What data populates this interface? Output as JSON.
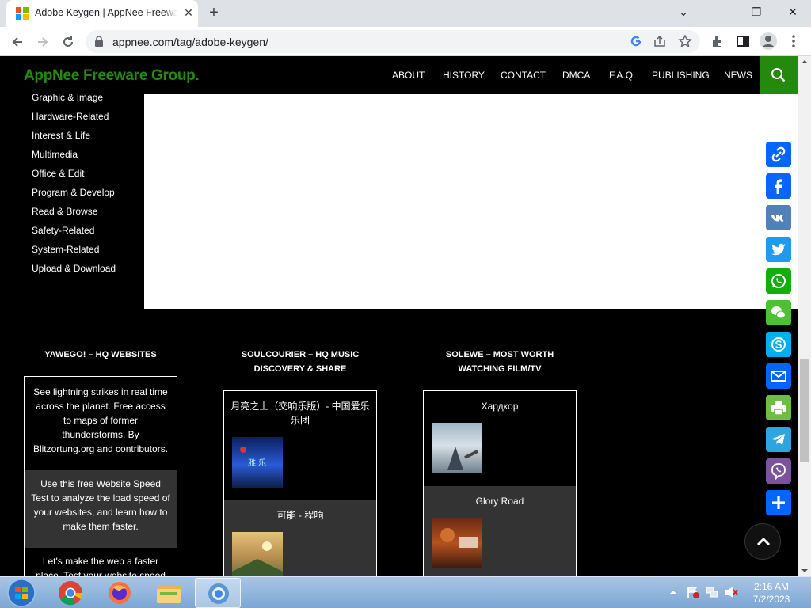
{
  "browser": {
    "tab_title": "Adobe Keygen | AppNee Freeware Group.",
    "tab_close": "✕",
    "new_tab": "+",
    "url": "appnee.com/tag/adobe-keygen/",
    "window": {
      "minimize": "—",
      "restore": "❐",
      "close": "✕",
      "tabsearch": "⌄"
    }
  },
  "site": {
    "title": "AppNee Freeware Group.",
    "nav": [
      "ABOUT",
      "HISTORY",
      "CONTACT",
      "DMCA",
      "F.A.Q.",
      "PUBLISHING",
      "NEWS"
    ],
    "accent": "#24890d"
  },
  "sidebar": {
    "categories": [
      "Graphic & Image",
      "Hardware-Related",
      "Interest & Life",
      "Multimedia",
      "Office & Edit",
      "Program & Develop",
      "Read & Browse",
      "Safety-Related",
      "System-Related",
      "Upload & Download"
    ]
  },
  "footer": {
    "col1": {
      "heading": "YAWEGO! – HQ WEBSITES",
      "items": [
        "See lightning strikes in real time across the planet. Free access to maps of former thunderstorms. By Blitzortung.org and contributors.",
        "Use this free Website Speed Test to analyze the load speed of your websites, and learn how to make them faster.",
        "Let's make the web a faster place. Test your website speed in"
      ]
    },
    "col2": {
      "heading_line1": "SOULCOURIER – HQ MUSIC",
      "heading_line2": "DISCOVERY & SHARE",
      "items": [
        "月亮之上（交响乐版）- 中国爱乐乐团",
        "可能 - 程响"
      ]
    },
    "col3": {
      "heading_line1": "SOLEWE – MOST WORTH",
      "heading_line2": "WATCHING FILM/TV",
      "items": [
        "Хардкор",
        "Glory Road"
      ]
    }
  },
  "share_buttons": [
    {
      "name": "copy-link",
      "color": "#0166ff"
    },
    {
      "name": "facebook",
      "color": "#0866ff"
    },
    {
      "name": "vk",
      "color": "#5281b8"
    },
    {
      "name": "twitter",
      "color": "#1d9bf0"
    },
    {
      "name": "whatsapp",
      "color": "#12af0a"
    },
    {
      "name": "wechat",
      "color": "#4ec034"
    },
    {
      "name": "skype",
      "color": "#00aff0"
    },
    {
      "name": "email",
      "color": "#0166ff"
    },
    {
      "name": "print",
      "color": "#6cbe45"
    },
    {
      "name": "telegram",
      "color": "#2ca5e0"
    },
    {
      "name": "viber",
      "color": "#7c529e"
    },
    {
      "name": "share-more",
      "color": "#0166ff"
    }
  ],
  "taskbar": {
    "time": "2:16 AM",
    "date": "7/2/2023"
  }
}
